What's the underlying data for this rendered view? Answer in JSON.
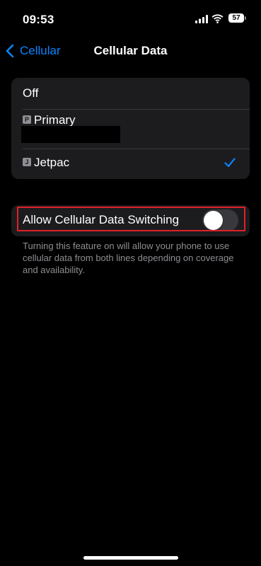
{
  "status_bar": {
    "time": "09:53",
    "battery_level": "57",
    "icons": [
      "signal-icon",
      "wifi-icon",
      "battery-icon"
    ]
  },
  "nav": {
    "back_label": "Cellular",
    "title": "Cellular Data",
    "accent_color": "#0a84ff"
  },
  "lines": {
    "items": [
      {
        "label": "Off",
        "badge": "",
        "selected": false
      },
      {
        "label": "Primary",
        "badge": "P",
        "selected": false
      },
      {
        "label": "Jetpac",
        "badge": "J",
        "selected": true
      }
    ]
  },
  "switching": {
    "label": "Allow Cellular Data Switching",
    "enabled": false,
    "highlight_color": "#e0202a",
    "footer": "Turning this feature on will allow your phone to use cellular data from both lines depending on coverage and availability."
  }
}
